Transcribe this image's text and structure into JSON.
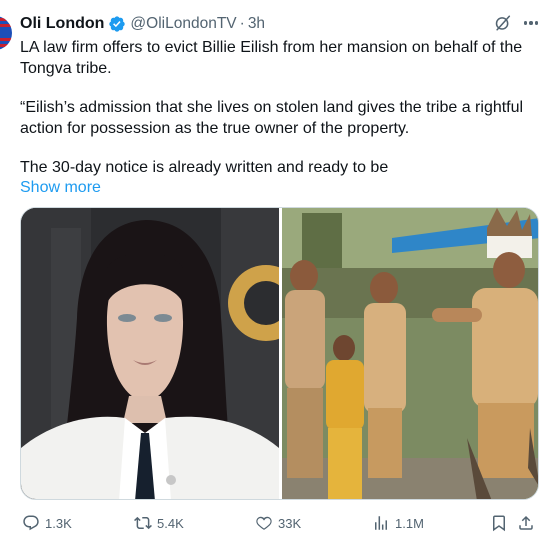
{
  "author": {
    "name": "Oli London",
    "handle": "@OliLondonTV",
    "separator": "·",
    "time": "3h"
  },
  "post": {
    "paragraph_1": "LA law firm offers to evict Billie Eilish from her mansion on behalf of the Tongva tribe.",
    "paragraph_2": "“Eilish’s admission that she lives on stolen land gives the tribe a rightful action for possession as the true owner of the property.",
    "paragraph_3": "The 30-day notice is already written and ready to be",
    "show_more": "Show more"
  },
  "metrics": {
    "replies": "1.3K",
    "reposts": "5.4K",
    "likes": "33K",
    "views": "1.1M"
  },
  "icons": {
    "verified": "verified-badge-icon",
    "grok": "grok-icon",
    "more": "more-icon",
    "reply": "reply-icon",
    "repost": "repost-icon",
    "like": "heart-icon",
    "views": "views-icon",
    "bookmark": "bookmark-icon",
    "share": "share-icon"
  },
  "colors": {
    "text": "#0f1419",
    "secondary": "#536471",
    "link": "#1d9bf0",
    "verified": "#1d9bf0",
    "border": "#cfd9de"
  }
}
